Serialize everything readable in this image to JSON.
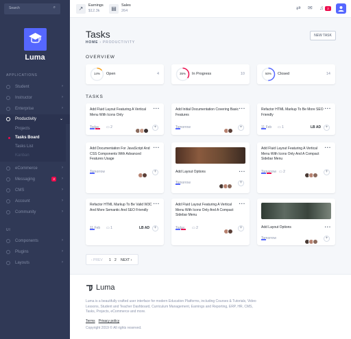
{
  "sidebar": {
    "search_placeholder": "Search",
    "brand": "Luma",
    "applications_heading": "APPLICATIONS",
    "items": [
      {
        "label": "Student"
      },
      {
        "label": "Instructor"
      },
      {
        "label": "Enterprise"
      },
      {
        "label": "Productivity"
      },
      {
        "label": "eCommerce"
      },
      {
        "label": "Messaging",
        "badge": "2"
      },
      {
        "label": "CMS"
      },
      {
        "label": "Account"
      },
      {
        "label": "Community"
      }
    ],
    "sub_items": [
      "Projects",
      "Tasks Board",
      "Tasks List",
      "Kanban"
    ],
    "ui_heading": "UI",
    "ui_items": [
      {
        "label": "Components"
      },
      {
        "label": "Plugins"
      },
      {
        "label": "Layouts"
      }
    ]
  },
  "topbar": {
    "earnings_label": "Earnings",
    "earnings_value": "$12.3k",
    "sales_label": "Sales",
    "sales_value": "264",
    "notif_count": "2"
  },
  "page": {
    "title": "Tasks",
    "crumb_home": "HOME",
    "crumb_current": "PRODUCTIVITY",
    "new_task": "NEW TASK",
    "overview_heading": "OVERVIEW",
    "tasks_heading": "TASKS"
  },
  "overview": [
    {
      "pct": "14%",
      "label": "Open",
      "count": "4",
      "color": "#f8a21d"
    },
    {
      "pct": "35%",
      "label": "In Progress",
      "count": "10",
      "color": "#ed0b4c"
    },
    {
      "pct": "50%",
      "label": "Closed",
      "count": "14",
      "color": "#5567ff"
    }
  ],
  "tasks": [
    {
      "title": "Add Fluid Layout Featuring A Vertical Menu With Icons Only",
      "meta": "Today",
      "comments": "2"
    },
    {
      "title": "Add Initial Documentation Covering Basic Features",
      "meta": "Tomorrow"
    },
    {
      "title": "Refactor HTML Markup To Be More SEO Friendly",
      "meta": "11 Feb",
      "comments": "1",
      "tag": "LB AD"
    },
    {
      "title": "Add Documentation For JavaScript And CSS Components With Advanced Features Usage",
      "meta": "Tomorrow"
    },
    {
      "sub": "Add Layout Options",
      "meta": "Tomorrow"
    },
    {
      "title": "Add Fluid Layout Featuring A Vertical Menu With Icons Only And A Compact Sidebar Menu",
      "meta": "Tomorrow",
      "comments": "2"
    },
    {
      "title": "Refactor HTML Markup To Be Valid W3C And More Semantic And SEO Friendly",
      "meta": "11 Feb",
      "comments": "1",
      "tag": "LB AD"
    },
    {
      "title": "Add Fluid Layout Featuring A Vertical Menu With Icons Only And A Compact Sidebar Menu",
      "meta": "Today",
      "comments": "2"
    },
    {
      "sub": "Add Layout Options",
      "meta": "Tomorrow"
    }
  ],
  "pager": {
    "prev": "‹ PREV",
    "p1": "1",
    "p2": "2",
    "next": "NEXT ›"
  },
  "footer": {
    "brand": "Luma",
    "text": "Luma is a beautifully crafted user interface for modern Education Platforms, including Courses & Tutorials, Video Lessons, Student and Teacher Dashboard, Curriculum Management, Earnings and Reporting, ERP, HR, CMS, Tasks, Projects, eCommerce and more.",
    "terms": "Terms",
    "privacy": "Privacy policy",
    "copyright": "Copyright 2019 © All rights reserved."
  },
  "colors": {
    "accent": "#5567ff",
    "danger": "#ed0b4c",
    "warning": "#f8a21d",
    "sidebar": "#303956"
  }
}
